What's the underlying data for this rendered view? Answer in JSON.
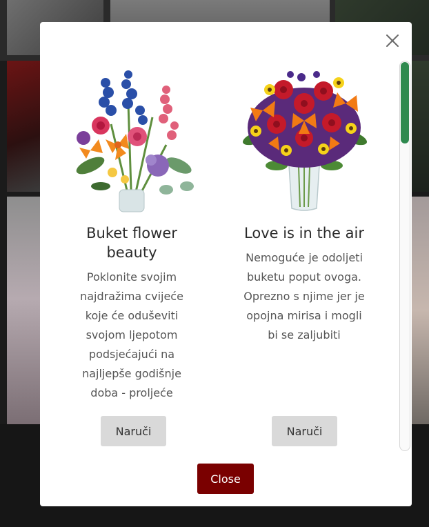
{
  "modal": {
    "close_icon": "close-icon",
    "close_button_label": "Close"
  },
  "products": [
    {
      "title": "Buket flower beauty",
      "description": "Poklonite svojim najdražima cvijeće koje će oduševiti svojom ljepotom podsjećajući na najljepše godišnje doba - proljeće",
      "order_label": "Naruči",
      "image_icon": "bouquet-image"
    },
    {
      "title": "Love is in the air",
      "description": "Nemoguće je odoljeti buketu poput ovoga. Oprezno s njime jer je opojna mirisa i mogli bi se zaljubiti",
      "order_label": "Naruči",
      "image_icon": "bouquet-vase-image"
    }
  ],
  "colors": {
    "close_button_bg": "#7a0000",
    "order_button_bg": "#d9d9d9",
    "scroll_thumb": "#2f8a4f"
  }
}
